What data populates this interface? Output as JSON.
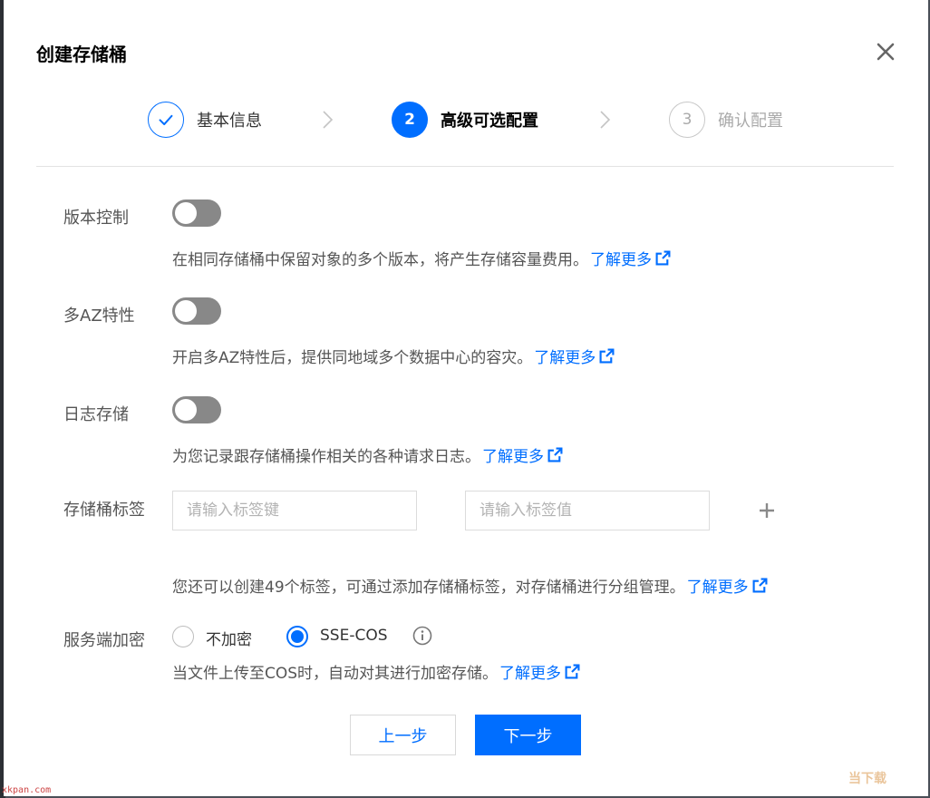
{
  "dialog": {
    "title": "创建存储桶"
  },
  "steps": [
    {
      "number": "",
      "label": "基本信息",
      "state": "done"
    },
    {
      "number": "2",
      "label": "高级可选配置",
      "state": "active"
    },
    {
      "number": "3",
      "label": "确认配置",
      "state": "pending"
    }
  ],
  "versioning": {
    "label": "版本控制",
    "enabled": false,
    "description": "在相同存储桶中保留对象的多个版本，将产生存储容量费用。",
    "link": "了解更多"
  },
  "multi_az": {
    "label": "多AZ特性",
    "enabled": false,
    "description": "开启多AZ特性后，提供同地域多个数据中心的容灾。",
    "link": "了解更多"
  },
  "logging": {
    "label": "日志存储",
    "enabled": false,
    "description": "为您记录跟存储桶操作相关的各种请求日志。",
    "link": "了解更多"
  },
  "tags": {
    "label": "存储桶标签",
    "key_placeholder": "请输入标签键",
    "value_placeholder": "请输入标签值",
    "key_value": "",
    "value_value": "",
    "description": "您还可以创建49个标签，可通过添加存储桶标签，对存储桶进行分组管理。",
    "link": "了解更多"
  },
  "encryption": {
    "label": "服务端加密",
    "options": [
      {
        "label": "不加密",
        "selected": false
      },
      {
        "label": "SSE-COS",
        "selected": true
      }
    ],
    "description": "当文件上传至COS时，自动对其进行加密存储。",
    "link": "了解更多"
  },
  "buttons": {
    "prev": "上一步",
    "next": "下一步"
  },
  "watermark": {
    "left": "xkpan.com",
    "right": "当下载"
  },
  "colors": {
    "accent": "#006eff",
    "toggle_off": "#888888"
  },
  "icons": {
    "close": "close-icon",
    "check": "check-icon",
    "chevron": "chevron-right-icon",
    "external": "external-link-icon",
    "plus": "plus-icon",
    "info": "info-icon"
  }
}
